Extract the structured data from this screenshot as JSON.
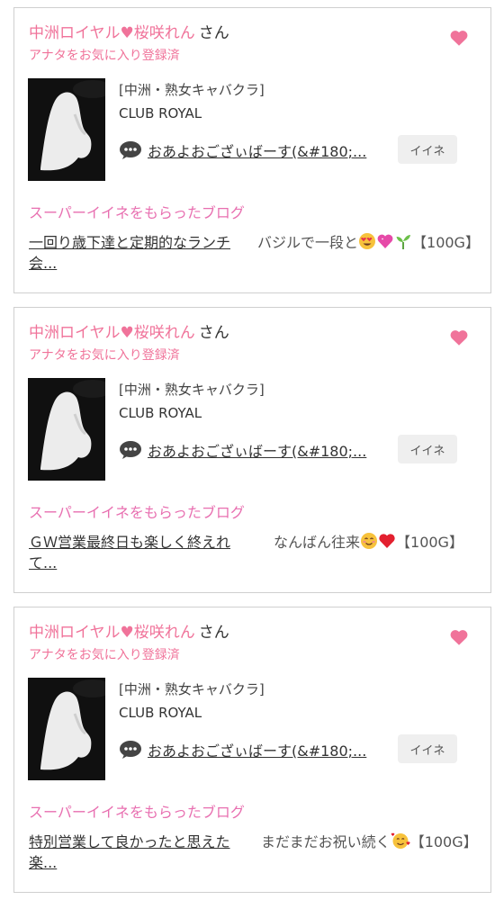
{
  "colors": {
    "accent": "#f0739a",
    "super": "#e86fb0",
    "border": "#cfcfcf",
    "button_bg": "#efefef"
  },
  "cards": [
    {
      "name": "中洲ロイヤル♥桜咲れん",
      "san": "さん",
      "fav_status": "アナタをお気に入り登録済",
      "shop_category": "[中洲・熟女キャバクラ]",
      "shop_name": "CLUB ROYAL",
      "comment": "おあよおござぃばーす(&#180;...",
      "iine_label": "イイネ",
      "super_label": "スーパーイイネをもらったブログ",
      "blog_title": "一回り歳下達と定期的なランチ会...",
      "blog_excerpt_text": "バジルで一段と",
      "blog_excerpt_end": "【100G】",
      "emojis": [
        "heart-eyes-face",
        "sparkling-heart",
        "seedling"
      ]
    },
    {
      "name": "中洲ロイヤル♥桜咲れん",
      "san": "さん",
      "fav_status": "アナタをお気に入り登録済",
      "shop_category": "[中洲・熟女キャバクラ]",
      "shop_name": "CLUB ROYAL",
      "comment": "おあよおござぃばーす(&#180;...",
      "iine_label": "イイネ",
      "super_label": "スーパーイイネをもらったブログ",
      "blog_title": "ＧＷ営業最終日も楽しく終えれて...",
      "blog_excerpt_text": "なんばん往来",
      "blog_excerpt_end": "【100G】",
      "emojis": [
        "smiling-face",
        "red-heart"
      ]
    },
    {
      "name": "中洲ロイヤル♥桜咲れん",
      "san": "さん",
      "fav_status": "アナタをお気に入り登録済",
      "shop_category": "[中洲・熟女キャバクラ]",
      "shop_name": "CLUB ROYAL",
      "comment": "おあよおござぃばーす(&#180;...",
      "iine_label": "イイネ",
      "super_label": "スーパーイイネをもらったブログ",
      "blog_title": "特別営業して良かったと思えた楽...",
      "blog_excerpt_text": "まだまだお祝い続く",
      "blog_excerpt_end": "【100G】",
      "emojis": [
        "smiling-face-with-hearts"
      ]
    }
  ]
}
